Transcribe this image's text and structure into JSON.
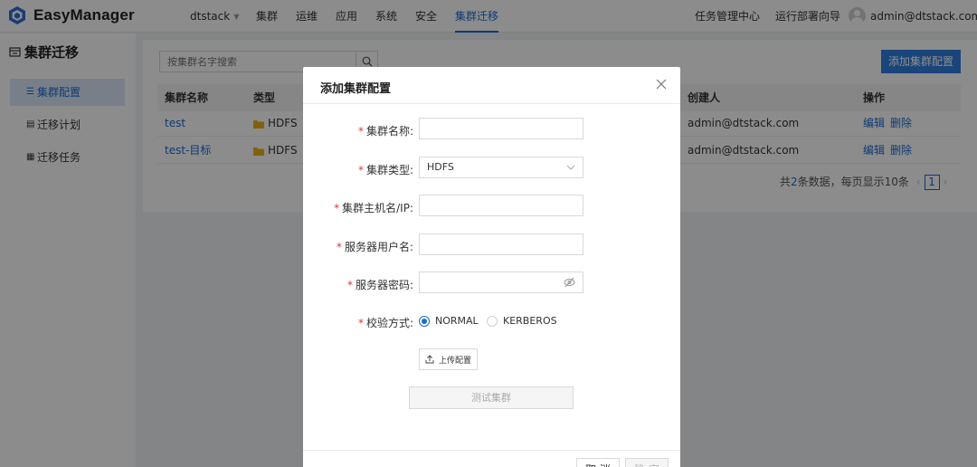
{
  "app": {
    "name": "EasyManager"
  },
  "topnav": {
    "items": [
      {
        "label": "dtstack",
        "dropdown": true
      },
      {
        "label": "集群"
      },
      {
        "label": "运维"
      },
      {
        "label": "应用"
      },
      {
        "label": "系统"
      },
      {
        "label": "安全"
      },
      {
        "label": "集群迁移",
        "active": true
      }
    ],
    "task_center": "任务管理中心",
    "deploy_wizard": "运行部署向导",
    "user": "admin@dtstack.com"
  },
  "sidebar": {
    "title": "集群迁移",
    "items": [
      {
        "label": "集群配置",
        "active": true
      },
      {
        "label": "迁移计划"
      },
      {
        "label": "迁移任务"
      }
    ]
  },
  "main": {
    "search_placeholder": "按集群名字搜索",
    "add_button": "添加集群配置",
    "table": {
      "columns": {
        "name": "集群名称",
        "type": "类型",
        "creator": "创建人",
        "actions": "操作"
      },
      "rows": [
        {
          "name": "test",
          "type": "HDFS",
          "creator": "admin@dtstack.com",
          "edit": "编辑",
          "delete": "删除"
        },
        {
          "name": "test-目标",
          "type": "HDFS",
          "creator": "admin@dtstack.com",
          "edit": "编辑",
          "delete": "删除"
        }
      ]
    },
    "pagination": {
      "prefix": "共",
      "total": "2",
      "suffix": "条数据，每页显示10条",
      "current_page": "1"
    }
  },
  "modal": {
    "title": "添加集群配置",
    "fields": {
      "cluster_name": "集群名称",
      "cluster_type": "集群类型",
      "cluster_type_value": "HDFS",
      "host": "集群主机名/IP",
      "username": "服务器用户名",
      "password": "服务器密码",
      "auth_method": "校验方式"
    },
    "required_mark": "*",
    "label_colon": ":",
    "auth_options": [
      {
        "label": "NORMAL",
        "checked": true
      },
      {
        "label": "KERBEROS",
        "checked": false
      }
    ],
    "upload_button": "上传配置",
    "test_button": "测试集群",
    "cancel_button": "取 消",
    "ok_button": "确 定"
  },
  "colors": {
    "primary": "#1a6bd6",
    "button": "#2f7fe0",
    "required": "#e0353d"
  },
  "icons": [
    "logo-icon",
    "chevron-down-icon",
    "user-avatar-icon",
    "cluster-migrate-icon",
    "list-icon",
    "search-icon",
    "hdfs-folder-icon",
    "chevron-left-icon",
    "chevron-right-icon",
    "close-icon",
    "eye-hidden-icon",
    "upload-icon"
  ]
}
